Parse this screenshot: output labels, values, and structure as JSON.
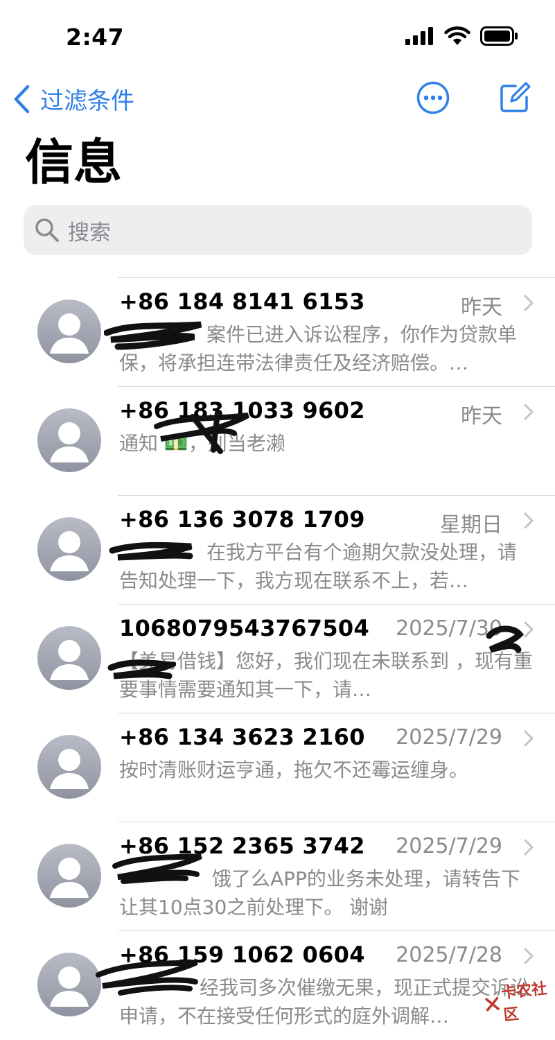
{
  "status_bar": {
    "time": "2:47",
    "icons": [
      "signal-icon",
      "wifi-icon",
      "battery-icon"
    ]
  },
  "nav": {
    "back_label": "过滤条件",
    "more_icon": "ellipsis-circle-icon",
    "compose_icon": "compose-icon"
  },
  "page": {
    "title": "信息"
  },
  "search": {
    "placeholder": "搜索"
  },
  "accent_color": "#2f80e8",
  "messages": [
    {
      "sender": "+86 184 8141 6153",
      "date": "昨天",
      "preview": "案件已进入诉讼程序，你作为贷款单保，将承担连带法律责任及经济赔偿。…"
    },
    {
      "sender": "+86 183 1033 9602",
      "date": "昨天",
      "preview": "通知 💵，别当老濑"
    },
    {
      "sender": "+86 136 3078 1709",
      "date": "星期日",
      "preview": "在我方平台有个逾期欠款没处理，请告知处理一下，我方现在联系不上，若…"
    },
    {
      "sender": "1068079543767504",
      "date": "2025/7/30",
      "preview": "【美易借钱】您好，我们现在未联系到 ，现有重要事情需要通知其一下，请…"
    },
    {
      "sender": "+86 134 3623 2160",
      "date": "2025/7/29",
      "preview": "按时清账财运亨通，拖欠不还霉运缠身。"
    },
    {
      "sender": "+86 152 2365 3742",
      "date": "2025/7/29",
      "preview": "饿了么APP的业务未处理，请转告下让其10点30之前处理下。 谢谢"
    },
    {
      "sender": "+86 159 1062 0604",
      "date": "2025/7/28",
      "preview": "经我司多次催缴无果，现正式提交诉讼申请，不在接受任何形式的庭外调解…"
    }
  ],
  "watermark": "卡农社区"
}
